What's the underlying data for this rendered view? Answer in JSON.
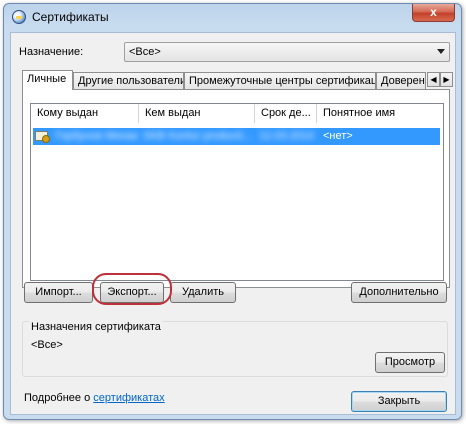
{
  "window": {
    "title": "Сертификаты",
    "close_glyph": "x"
  },
  "purpose": {
    "label": "Назначение:",
    "value": "<Все>"
  },
  "tabs": [
    {
      "label": "Личные",
      "active": true
    },
    {
      "label": "Другие пользователи"
    },
    {
      "label": "Промежуточные центры сертификации"
    },
    {
      "label": "Доверенн"
    }
  ],
  "tab_scroll": {
    "left": "◀",
    "right": "▶"
  },
  "table": {
    "columns": [
      "Кому выдан",
      "Кем выдан",
      "Срок де...",
      "Понятное имя"
    ],
    "rows": [
      {
        "issued_to": "Горбунов Михаи...",
        "issued_by": "SKB Kontur producti...",
        "expires": "12.03.2014",
        "friendly_name": "<нет>",
        "selected": true
      }
    ]
  },
  "buttons": {
    "import": "Импорт...",
    "export": "Экспорт...",
    "delete": "Удалить",
    "advanced": "Дополнительно",
    "view": "Просмотр",
    "close": "Закрыть"
  },
  "cert_purposes": {
    "title": "Назначения сертификата",
    "value": "<Все>"
  },
  "footer": {
    "prefix": "Подробнее о ",
    "link": "сертификатах"
  },
  "colors": {
    "selection": "#3399ff",
    "highlight_ring": "#c0303a",
    "link": "#0066cc"
  }
}
